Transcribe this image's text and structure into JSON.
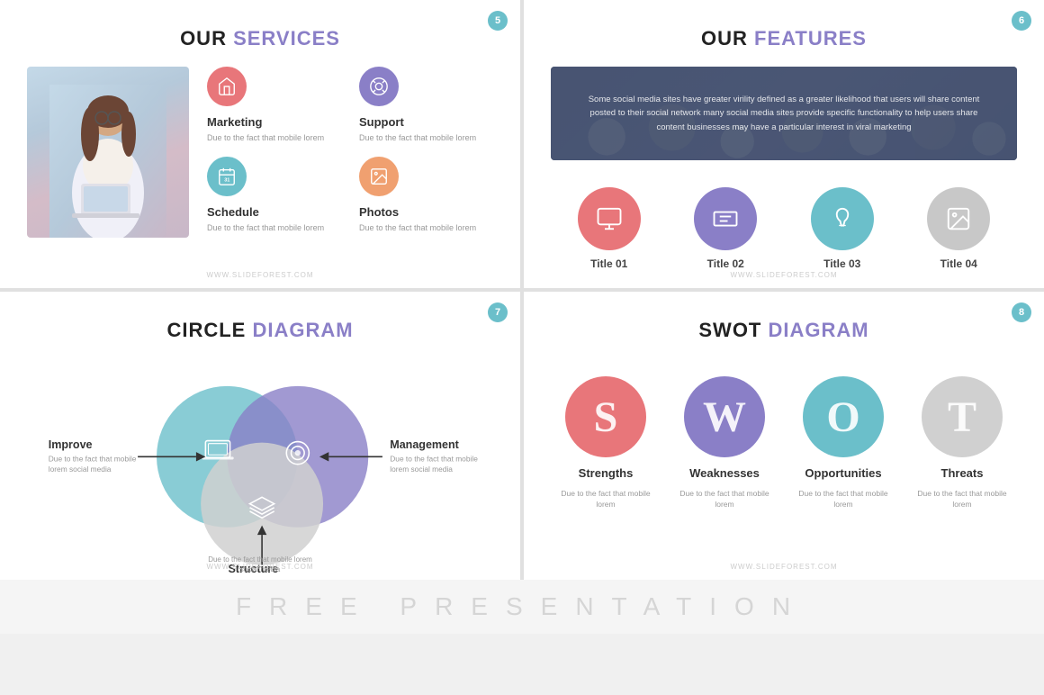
{
  "slides": {
    "slide1": {
      "badge": "5",
      "title_normal": "OUR",
      "title_accent": "SERVICES",
      "services": [
        {
          "name": "Marketing",
          "desc": "Due to the fact that mobile lorem",
          "icon": "home",
          "color": "pink"
        },
        {
          "name": "Support",
          "desc": "Due to the fact that mobile lorem",
          "icon": "target",
          "color": "purple"
        },
        {
          "name": "Schedule",
          "desc": "Due to the fact that mobile lorem",
          "icon": "calendar",
          "color": "teal"
        },
        {
          "name": "Photos",
          "desc": "Due to the fact that mobile lorem",
          "icon": "image",
          "color": "orange"
        }
      ],
      "watermark": "WWW.SLIDEFOREST.COM"
    },
    "slide2": {
      "badge": "6",
      "title_normal": "OUR",
      "title_accent": "FEATURES",
      "banner_text": "Some social media sites have greater virility defined as a greater likelihood that users will share content posted to their social network many social media sites provide specific functionality to help users share content businesses may have a particular interest in viral marketing",
      "features": [
        {
          "title": "Title 01",
          "color": "pink"
        },
        {
          "title": "Title 02",
          "color": "purple"
        },
        {
          "title": "Title 03",
          "color": "teal"
        },
        {
          "title": "Title 04",
          "color": "gray"
        }
      ],
      "watermark": "WWW.SLIDEFOREST.COM"
    },
    "slide3": {
      "badge": "7",
      "title_normal": "CIRCLE",
      "title_accent": "DIAGRAM",
      "labels": {
        "improve": {
          "title": "Improve",
          "desc": "Due to the fact that mobile lorem social media"
        },
        "management": {
          "title": "Management",
          "desc": "Due to the fact that mobile lorem social media"
        },
        "structure": {
          "title": "Structure",
          "desc": "Due to the fact that mobile lorem social media"
        }
      },
      "watermark": "WWW.SLIDEFOREST.COM"
    },
    "slide4": {
      "badge": "8",
      "title_normal": "SWOT",
      "title_accent": "DIAGRAM",
      "swot": [
        {
          "letter": "S",
          "name": "Strengths",
          "desc": "Due to the fact that mobile lorem",
          "color": "s"
        },
        {
          "letter": "W",
          "name": "Weaknesses",
          "desc": "Due to the fact that mobile lorem",
          "color": "w"
        },
        {
          "letter": "O",
          "name": "Opportunities",
          "desc": "Due to the fact that mobile lorem",
          "color": "o"
        },
        {
          "letter": "T",
          "name": "Threats",
          "desc": "Due to the fact that mobile lorem",
          "color": "t"
        }
      ],
      "watermark": "WWW.SLIDEFOREST.COM"
    }
  },
  "footer": {
    "text": "FREE  PRESENTATION"
  },
  "colors": {
    "pink": "#e8767a",
    "purple": "#8a7fc7",
    "teal": "#6bbfca",
    "orange": "#f0a070",
    "gray": "#c8c8c8",
    "accent_purple": "#8a7fc7"
  }
}
